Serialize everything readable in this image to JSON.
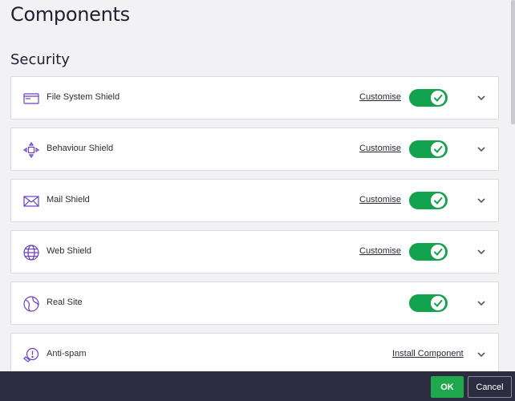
{
  "page": {
    "title": "Components"
  },
  "section": {
    "title": "Security"
  },
  "components": [
    {
      "label": "File System Shield",
      "action": "Customise",
      "icon": "file-system-shield-icon",
      "enabled": true
    },
    {
      "label": "Behaviour Shield",
      "action": "Customise",
      "icon": "behaviour-shield-icon",
      "enabled": true
    },
    {
      "label": "Mail Shield",
      "action": "Customise",
      "icon": "mail-shield-icon",
      "enabled": true
    },
    {
      "label": "Web Shield",
      "action": "Customise",
      "icon": "web-shield-icon",
      "enabled": true
    },
    {
      "label": "Real Site",
      "action": "",
      "icon": "real-site-icon",
      "enabled": true
    },
    {
      "label": "Anti-spam",
      "action": "Install Component",
      "icon": "anti-spam-icon",
      "enabled": false
    }
  ],
  "footer": {
    "ok_label": "OK",
    "cancel_label": "Cancel"
  },
  "colors": {
    "accent": "#12a34d",
    "icon": "#6a3fc4",
    "footer_bg": "#2b2c3f"
  }
}
